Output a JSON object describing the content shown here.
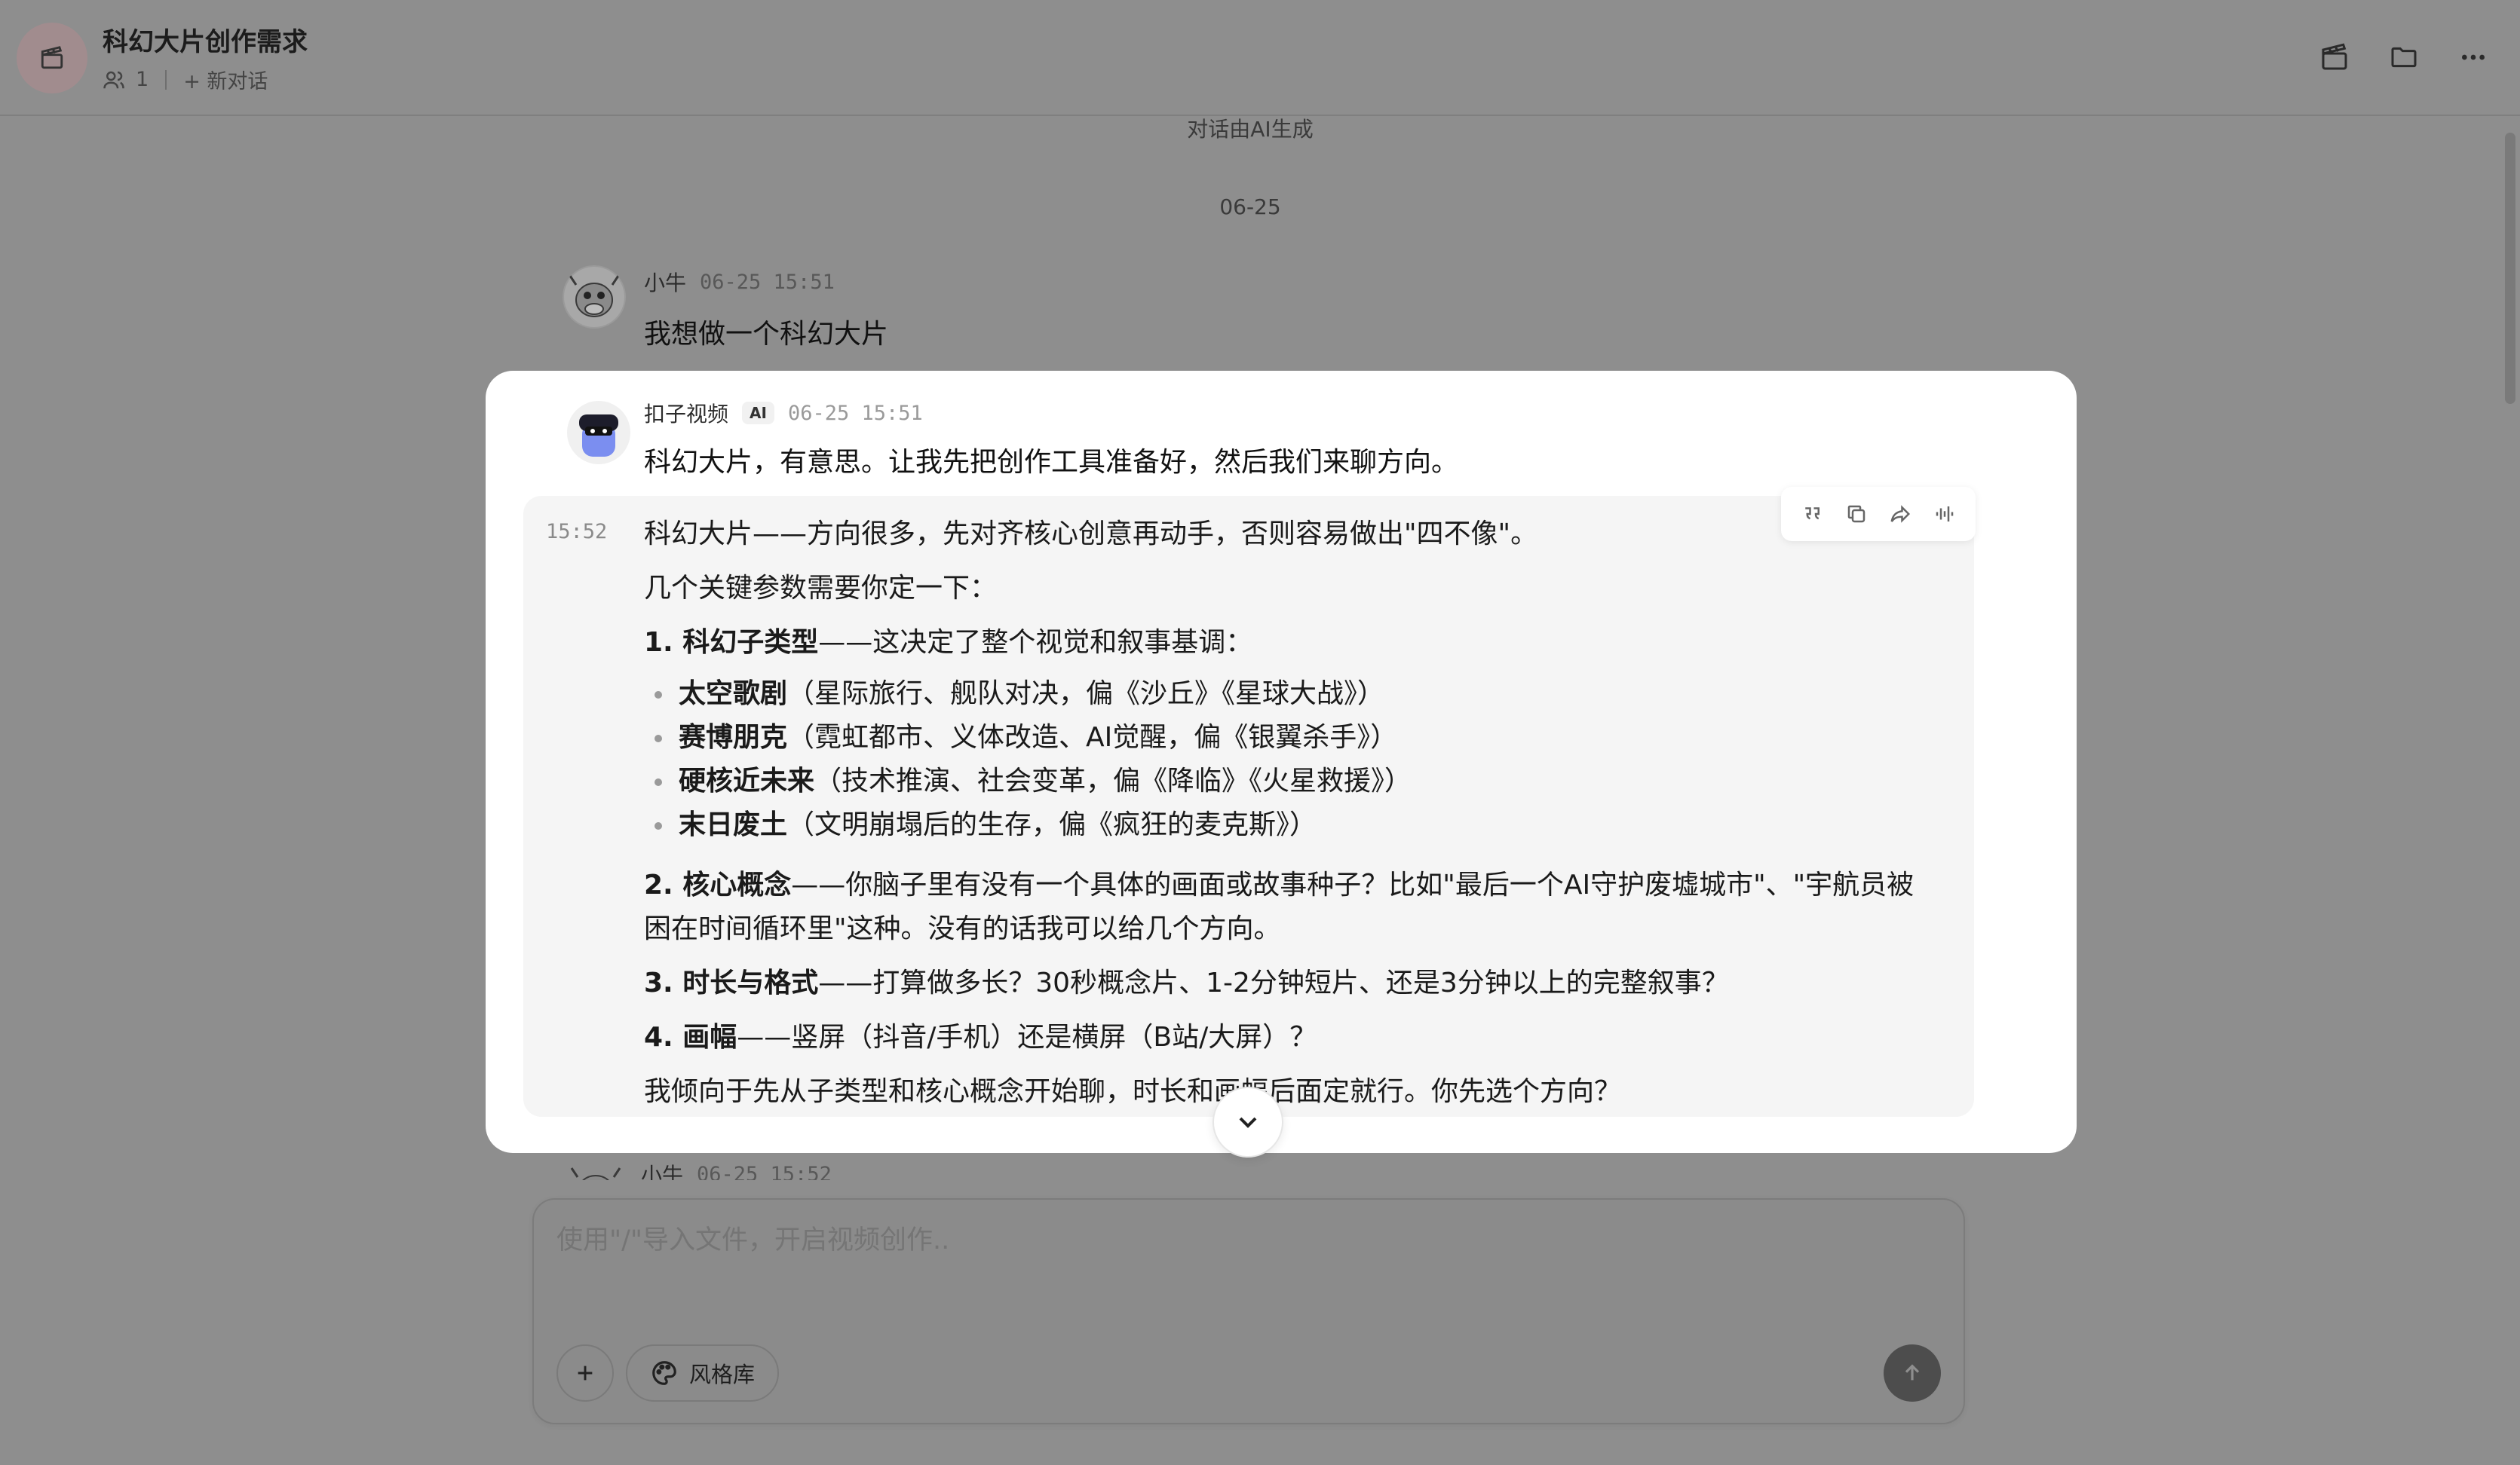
{
  "header": {
    "title": "科幻大片创作需求",
    "member_count": "1",
    "new_chat_label": "+ 新对话",
    "icons": [
      "clapperboard-icon",
      "folder-icon",
      "more-icon"
    ]
  },
  "notice": {
    "ai_generated": "对话由AI生成",
    "date_divider": "06-25"
  },
  "messages": {
    "user_1": {
      "sender": "小牛",
      "time": "06-25 15:51",
      "text": "我想做一个科幻大片"
    },
    "ai_1": {
      "sender": "扣子视频",
      "badge": "AI",
      "time": "06-25 15:51",
      "text": "科幻大片，有意思。让我先把创作工具准备好，然后我们来聊方向。"
    },
    "ai_2": {
      "time": "15:52",
      "intro": "科幻大片——方向很多，先对齐核心创意再动手，否则容易做出\"四不像\"。",
      "params_intro": "几个关键参数需要你定一下：",
      "item1_title": "1. 科幻子类型",
      "item1_rest": "——这决定了整个视觉和叙事基调：",
      "bullets": [
        {
          "title": "太空歌剧",
          "desc": "（星际旅行、舰队对决，偏《沙丘》《星球大战》）"
        },
        {
          "title": "赛博朋克",
          "desc": "（霓虹都市、义体改造、AI觉醒，偏《银翼杀手》）"
        },
        {
          "title": "硬核近未来",
          "desc": "（技术推演、社会变革，偏《降临》《火星救援》）"
        },
        {
          "title": "末日废土",
          "desc": "（文明崩塌后的生存，偏《疯狂的麦克斯》）"
        }
      ],
      "item2_title": "2. 核心概念",
      "item2_rest": "——你脑子里有没有一个具体的画面或故事种子？比如\"最后一个AI守护废墟城市\"、\"宇航员被困在时间循环里\"这种。没有的话我可以给几个方向。",
      "item3_title": "3. 时长与格式",
      "item3_rest": "——打算做多长？30秒概念片、1-2分钟短片、还是3分钟以上的完整叙事？",
      "item4_title": "4. 画幅",
      "item4_rest": "——竖屏（抖音/手机）还是横屏（B站/大屏）？",
      "closing": "我倾向于先从子类型和核心概念开始聊，时长和画幅后面定就行。你先选个方向？"
    },
    "user_2_peek": {
      "sender": "小牛",
      "time": "06-25 15:52"
    }
  },
  "composer": {
    "placeholder": "使用\"/\"导入文件，开启视频创作..",
    "style_library_label": "风格库"
  }
}
